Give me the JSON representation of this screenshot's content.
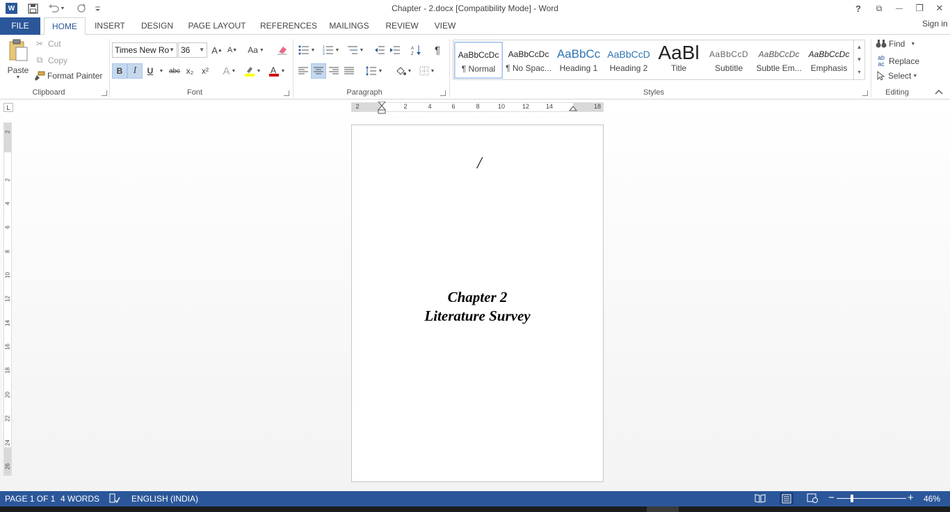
{
  "window": {
    "title": "Chapter - 2.docx [Compatibility Mode] - Word",
    "app_icon": "W",
    "help": "?",
    "ribbon_display": "⧉",
    "minimize": "—",
    "restore": "❐",
    "close": "✕"
  },
  "qat": {
    "save": "save-icon",
    "undo": "undo-icon",
    "redo": "redo-icon",
    "customize": "customize-icon"
  },
  "tabs": [
    {
      "label": "FILE"
    },
    {
      "label": "HOME"
    },
    {
      "label": "INSERT"
    },
    {
      "label": "DESIGN"
    },
    {
      "label": "PAGE LAYOUT"
    },
    {
      "label": "REFERENCES"
    },
    {
      "label": "MAILINGS"
    },
    {
      "label": "REVIEW"
    },
    {
      "label": "VIEW"
    }
  ],
  "signin": "Sign in",
  "clipboard": {
    "paste": "Paste",
    "cut": "Cut",
    "copy": "Copy",
    "format_painter": "Format Painter",
    "label": "Clipboard"
  },
  "font": {
    "family": "Times New Ro",
    "size": "36",
    "label": "Font",
    "case_btn": "Aa",
    "bold": "B",
    "italic": "I",
    "underline": "U",
    "strike": "abc",
    "subscript": "x₂",
    "superscript": "x²"
  },
  "paragraph": {
    "label": "Paragraph",
    "pilcrow": "¶"
  },
  "styles": {
    "label": "Styles",
    "items": [
      {
        "sample": "AaBbCcDc",
        "name": "¶ Normal"
      },
      {
        "sample": "AaBbCcDc",
        "name": "¶ No Spac..."
      },
      {
        "sample": "AaBbCc",
        "name": "Heading 1"
      },
      {
        "sample": "AaBbCcD",
        "name": "Heading 2"
      },
      {
        "sample": "AaBl",
        "name": "Title"
      },
      {
        "sample": "AaBbCcD",
        "name": "Subtitle"
      },
      {
        "sample": "AaBbCcDc",
        "name": "Subtle Em..."
      },
      {
        "sample": "AaBbCcDc",
        "name": "Emphasis"
      }
    ]
  },
  "editing": {
    "label": "Editing",
    "find": "Find",
    "replace": "Replace",
    "select": "Select"
  },
  "ruler": {
    "corner": "L",
    "h_numbers": [
      "2",
      "2",
      "4",
      "6",
      "8",
      "10",
      "12",
      "14",
      "18"
    ],
    "v_numbers": [
      "2",
      "2",
      "4",
      "6",
      "8",
      "10",
      "12",
      "14",
      "16",
      "18",
      "20",
      "22",
      "24",
      "26"
    ]
  },
  "document": {
    "mark": "/",
    "line1": "Chapter 2",
    "line2": "Literature Survey"
  },
  "status": {
    "page": "PAGE 1 OF 1",
    "words": "4 WORDS",
    "language": "ENGLISH (INDIA)",
    "zoom": "46%",
    "zoom_minus": "−",
    "zoom_plus": "+"
  },
  "colors": {
    "accent": "#2b579a",
    "highlight": "#ffff00",
    "font_color": "#d00000"
  }
}
